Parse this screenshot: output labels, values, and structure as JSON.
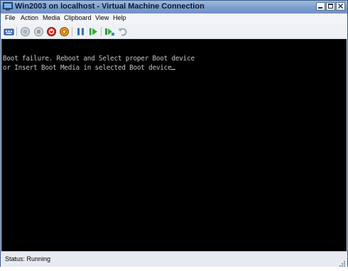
{
  "window": {
    "title": "Win2003 on localhost - Virtual Machine Connection"
  },
  "menu": {
    "items": [
      "File",
      "Action",
      "Media",
      "Clipboard",
      "View",
      "Help"
    ]
  },
  "toolbar": {
    "buttons": [
      {
        "name": "ctrl-alt-del-icon"
      },
      {
        "name": "start-icon"
      },
      {
        "name": "turn-off-icon"
      },
      {
        "name": "shutdown-icon"
      },
      {
        "name": "save-state-icon"
      },
      {
        "name": "pause-icon"
      },
      {
        "name": "resume-icon"
      },
      {
        "name": "snapshot-icon"
      },
      {
        "name": "revert-icon"
      }
    ]
  },
  "console": {
    "lines": [
      "Boot failure. Reboot and Select proper Boot device",
      "or Insert Boot Media in selected Boot device"
    ]
  },
  "status": {
    "text": "Status: Running"
  },
  "colors": {
    "titlebar": "#7c9dcd",
    "console_bg": "#000000",
    "console_text": "#c8c8c8"
  }
}
